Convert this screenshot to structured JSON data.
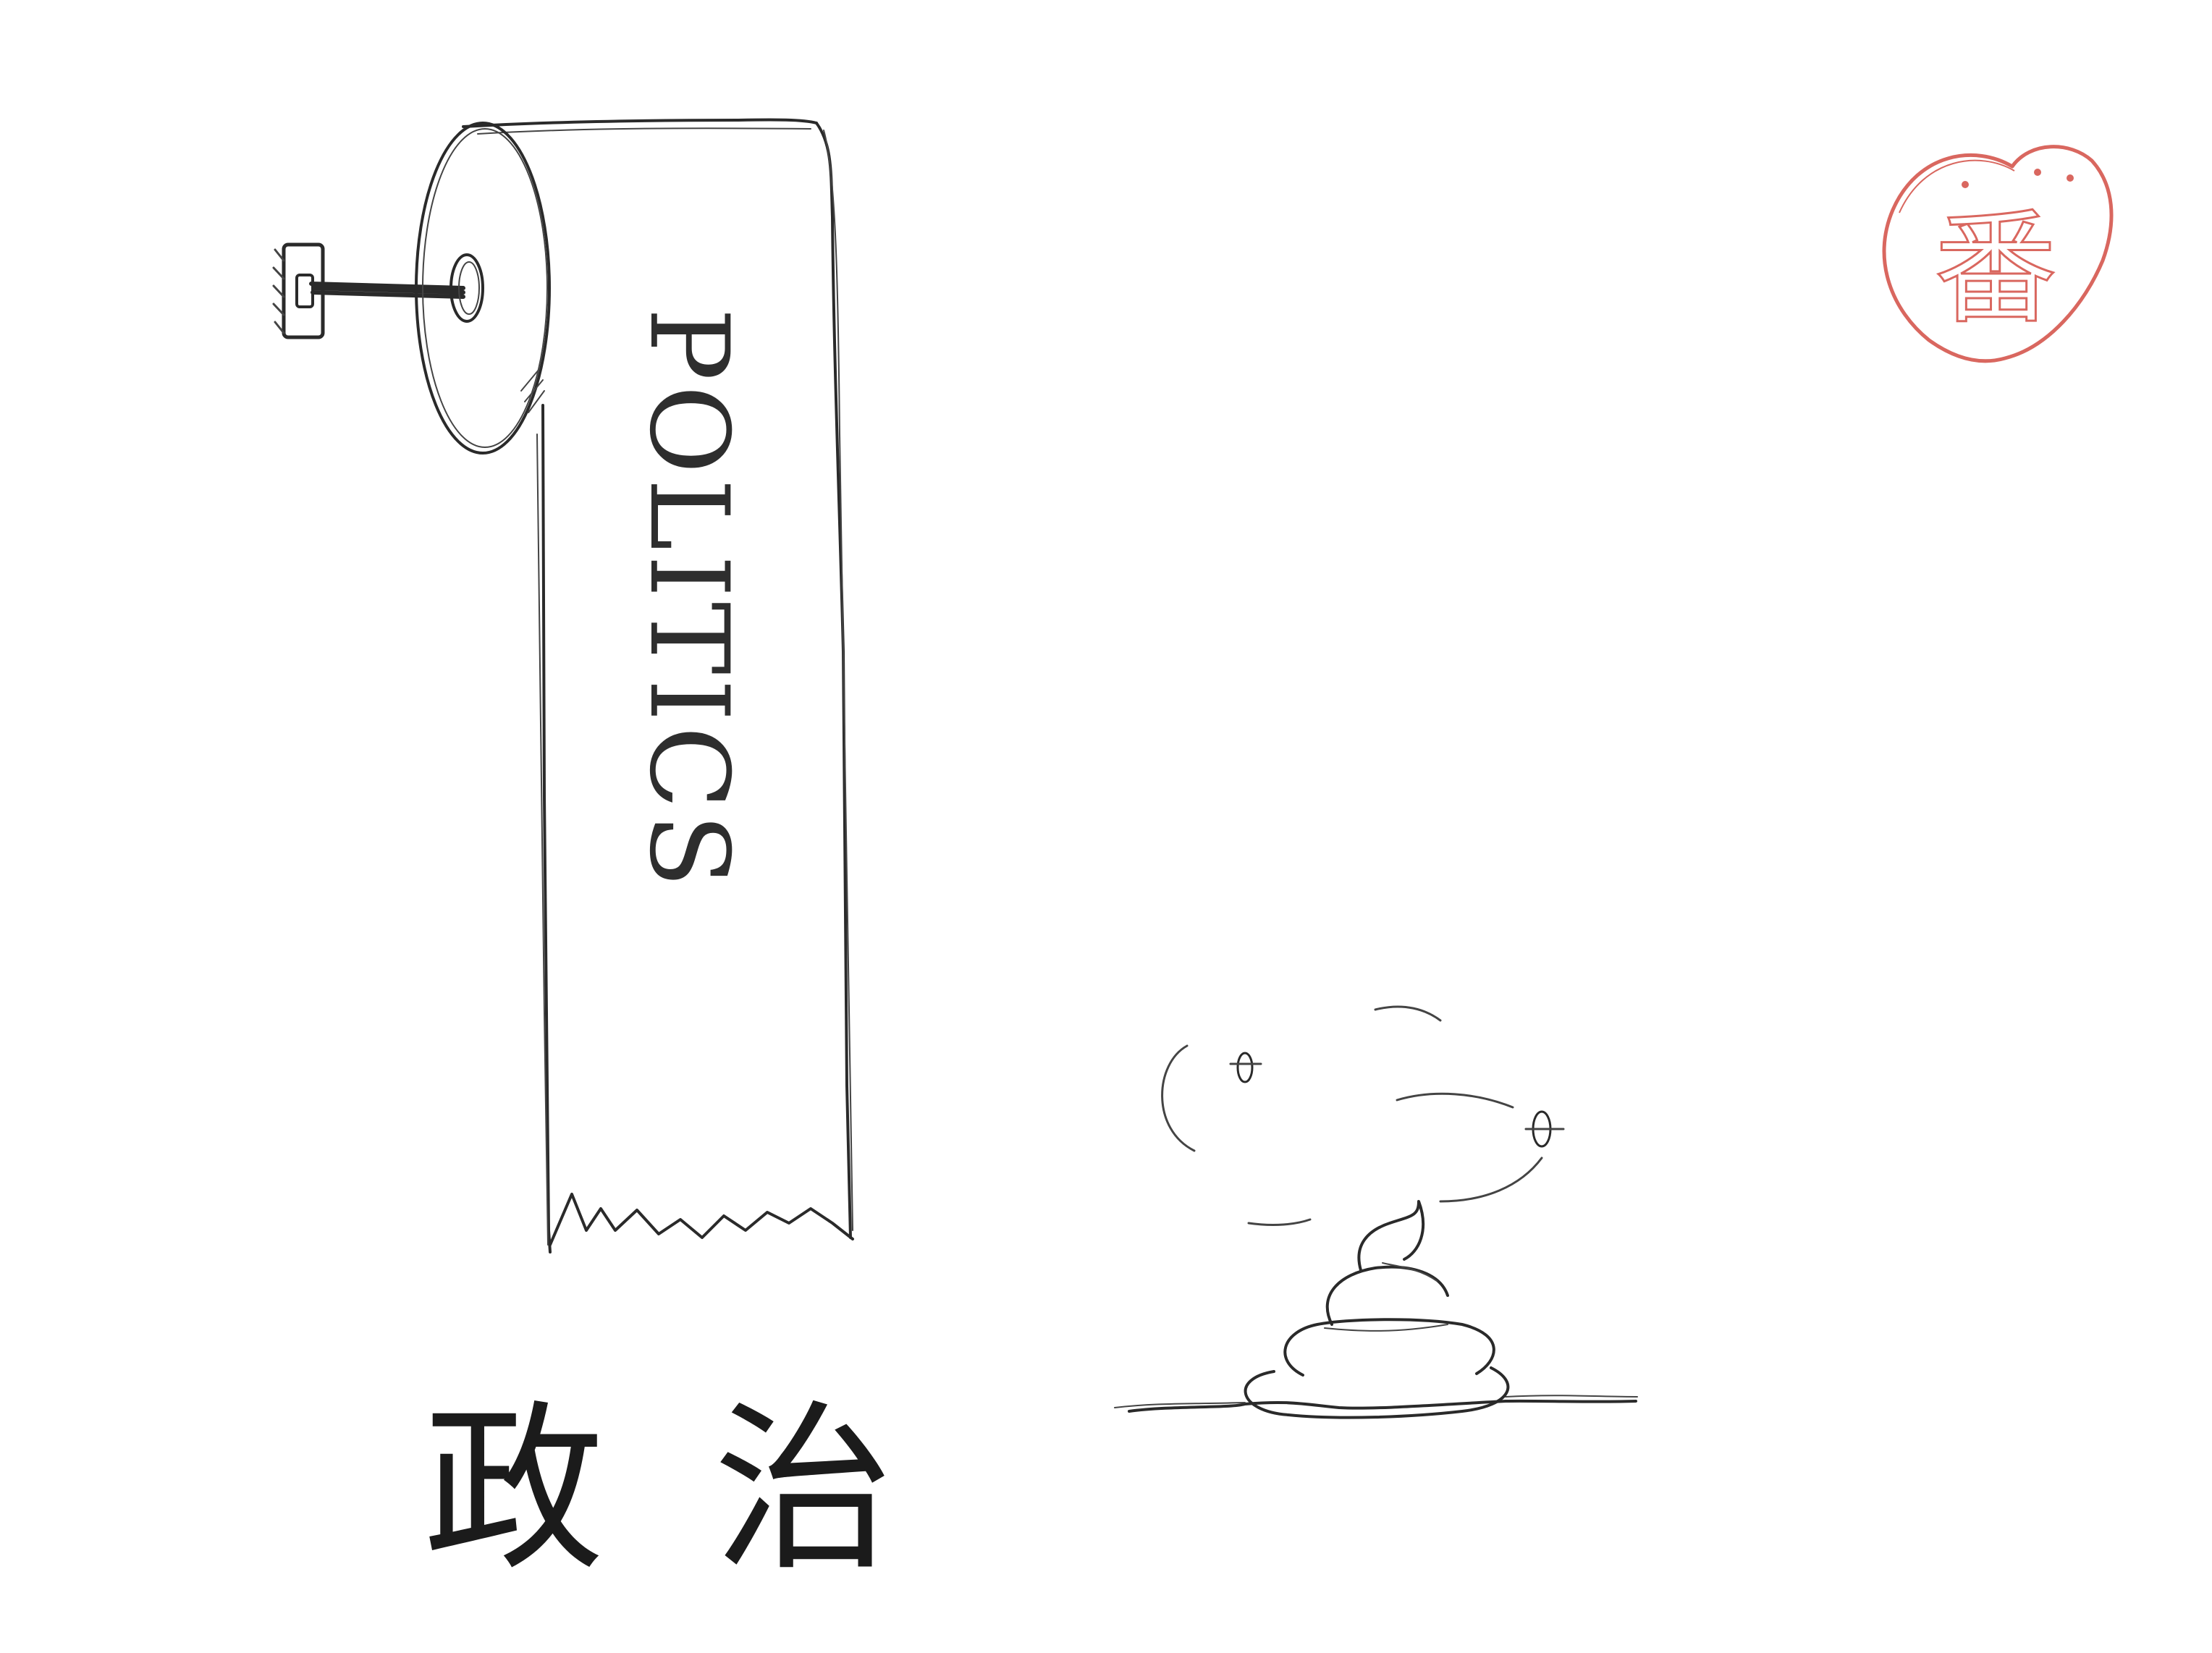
{
  "roll": {
    "text": "POLITICS"
  },
  "caption": {
    "text": "政治"
  },
  "seal": {
    "text": "番",
    "color": "#d9675f"
  },
  "colors": {
    "ink": "#2a2a2a",
    "background": "#ffffff",
    "seal": "#d9675f"
  },
  "icons": {
    "holder": "toilet-paper-holder-icon",
    "roll": "toilet-paper-roll-icon",
    "poop": "poop-icon",
    "flies": "fly-icon",
    "seal": "heart-seal-icon"
  }
}
